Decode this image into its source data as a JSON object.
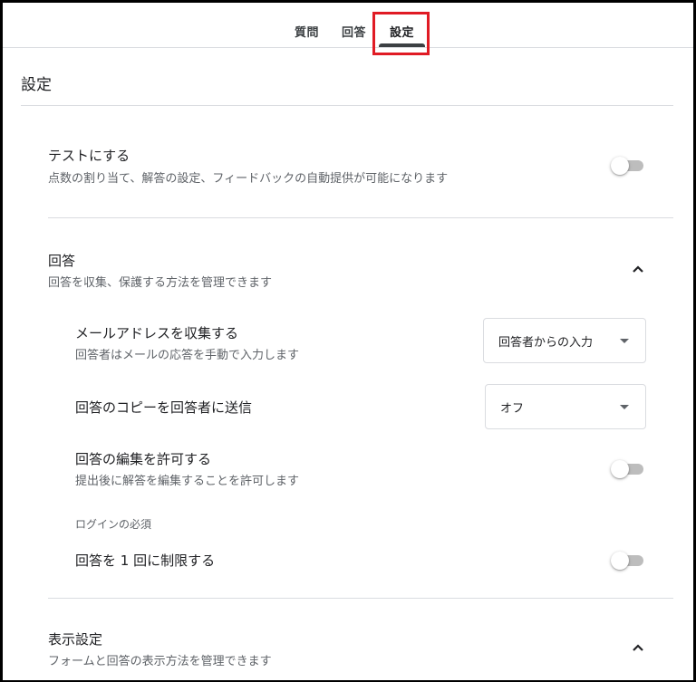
{
  "tabs": [
    {
      "label": "質問"
    },
    {
      "label": "回答"
    },
    {
      "label": "設定"
    }
  ],
  "page_title": "設定",
  "quiz": {
    "title": "テストにする",
    "description": "点数の割り当て、解答の設定、フィードバックの自動提供が可能になります",
    "enabled": false
  },
  "responses": {
    "title": "回答",
    "description": "回答を収集、保護する方法を管理できます",
    "collect_email": {
      "title": "メールアドレスを収集する",
      "description": "回答者はメールの応答を手動で入力します",
      "selected": "回答者からの入力"
    },
    "send_copy": {
      "title": "回答のコピーを回答者に送信",
      "selected": "オフ"
    },
    "allow_edit": {
      "title": "回答の編集を許可する",
      "description": "提出後に解答を編集することを許可します",
      "enabled": false
    },
    "login_required_label": "ログインの必須",
    "limit_one": {
      "title": "回答を 1 回に制限する",
      "enabled": false
    }
  },
  "presentation": {
    "title": "表示設定",
    "description": "フォームと回答の表示方法を管理できます"
  },
  "colors": {
    "highlight": "#e01b24",
    "toggle_track_off": "#bdbdbd",
    "divider": "#dadce0"
  }
}
